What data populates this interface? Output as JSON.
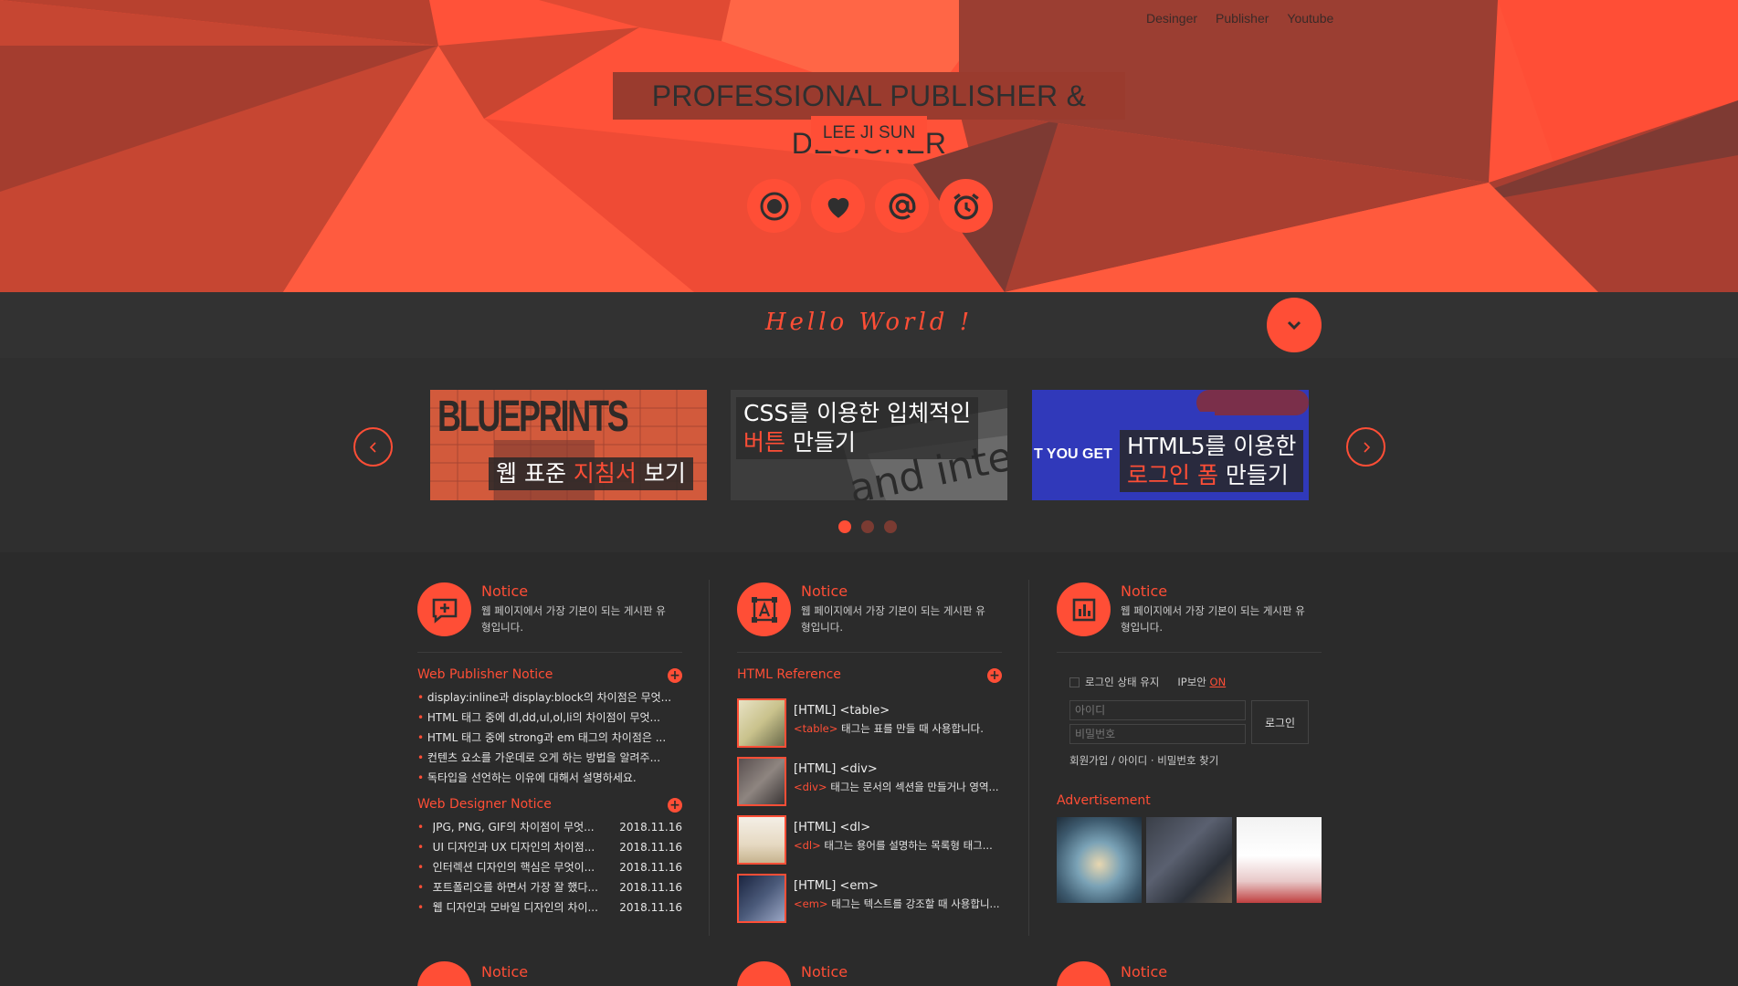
{
  "nav": {
    "links": [
      "Desinger",
      "Publisher",
      "Youtube"
    ]
  },
  "hero": {
    "title": "PROFESSIONAL PUBLISHER & DESIGNER",
    "subtitle": "LEE JI SUN",
    "icons": [
      "record-icon",
      "heart-icon",
      "at-icon",
      "alarm-icon"
    ]
  },
  "hello": {
    "text": "Hello World !"
  },
  "slider": {
    "slides": [
      {
        "bg_text": "BLUEPRINTS",
        "cap_pre": "웹 표준 ",
        "cap_hl": "지침서",
        "cap_post": " 보기"
      },
      {
        "line1": "CSS를 이용한 입체적인",
        "cap_hl": "버튼",
        "cap_post": " 만들기"
      },
      {
        "bg_text": "T YOU GET",
        "line1": "HTML5를 이용한",
        "cap_hl": "로그인 폼",
        "cap_post": " 만들기"
      }
    ],
    "active_dot": 0
  },
  "notice": {
    "title": "Notice",
    "desc": "웹 페이지에서 가장 기본이 되는 게시판 유형입니다."
  },
  "publisher": {
    "title": "Web Publisher Notice",
    "items": [
      "display:inline과 display:block의 차이점은 무엇...",
      "HTML 태그 중에 dl,dd,ul,ol,li의 차이점이 무엇...",
      "HTML 태그 중에 strong과 em 태그의 차이점은 ...",
      "컨텐츠 요소를 가운데로 오게 하는 방법을 알려주...",
      "독타입을 선언하는 이유에 대해서 설명하세요."
    ]
  },
  "designer": {
    "title": "Web Designer Notice",
    "items": [
      {
        "t": "JPG, PNG, GIF의 차이점이 무엇...",
        "d": "2018.11.16"
      },
      {
        "t": "UI 디자인과 UX 디자인의 차이점...",
        "d": "2018.11.16"
      },
      {
        "t": "인터렉션 디자인의 핵심은 무엇이...",
        "d": "2018.11.16"
      },
      {
        "t": "포트폴리오를 하면서 가장 잘 했다...",
        "d": "2018.11.16"
      },
      {
        "t": "웹 디자인과 모바일 디자인의 차이...",
        "d": "2018.11.16"
      }
    ]
  },
  "reference": {
    "title": "HTML Reference",
    "items": [
      {
        "t": "[HTML] <table>",
        "tag": "<table>",
        "d": " 태그는 표를 만들 때 사용합니다."
      },
      {
        "t": "[HTML] <div>",
        "tag": "<div>",
        "d": " 태그는 문서의 섹션을 만들거나 영역..."
      },
      {
        "t": "[HTML] <dl>",
        "tag": "<dl>",
        "d": " 태그는 용어를 설명하는 목록형 태그..."
      },
      {
        "t": "[HTML] <em>",
        "tag": "<em>",
        "d": " 태그는 텍스트를 강조할 때 사용합니..."
      }
    ]
  },
  "login": {
    "keep": "로그인 상태 유지",
    "security": "IP보안",
    "security_state": "ON",
    "id_placeholder": "아이디",
    "pw_placeholder": "비밀번호",
    "button": "로그인",
    "links": "회원가입 / 아이디 · 비밀번호 찾기"
  },
  "ad": {
    "title": "Advertisement"
  },
  "colors": {
    "accent": "#ff4e36",
    "dark": "#2f2f2f"
  }
}
